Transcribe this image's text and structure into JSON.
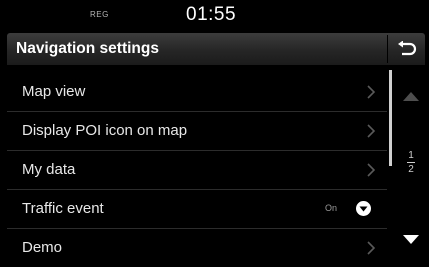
{
  "status_bar": {
    "indicator": "REG",
    "time": "01:55"
  },
  "header": {
    "title": "Navigation settings",
    "back_icon": "back-arrow-icon"
  },
  "menu": {
    "items": [
      {
        "label": "Map view",
        "icon": "chevron-right-icon"
      },
      {
        "label": "Display POI icon on map",
        "icon": "chevron-right-icon"
      },
      {
        "label": "My data",
        "icon": "chevron-right-icon"
      },
      {
        "label": "Traffic event",
        "state": "On",
        "icon": "chevron-down-circle-icon"
      },
      {
        "label": "Demo",
        "icon": "chevron-right-icon"
      }
    ]
  },
  "scroll": {
    "current_page": "1",
    "total_pages": "2",
    "up_icon": "scroll-up-icon",
    "down_icon": "scroll-down-icon"
  },
  "colors": {
    "background": "#000000",
    "header": "#2a2a2a",
    "text": "#e8e8e8",
    "divider": "#2c2c2c"
  }
}
